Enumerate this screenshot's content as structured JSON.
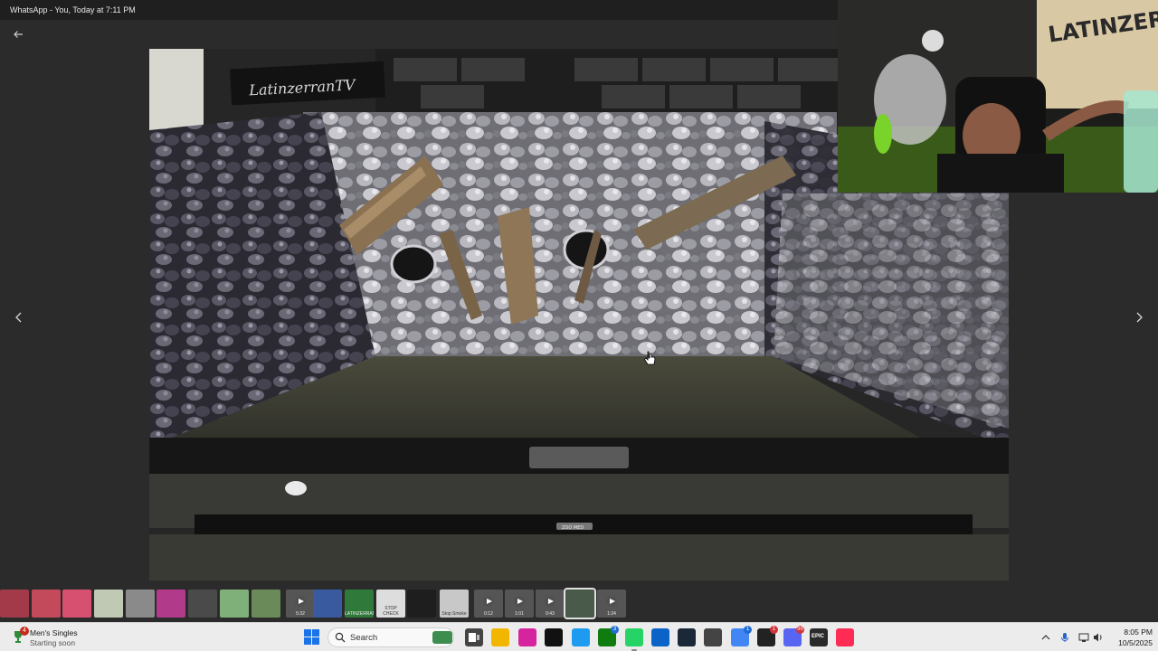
{
  "window": {
    "title": "WhatsApp - You, Today at 7:11 PM"
  },
  "viewer": {
    "back_icon": "arrow-left-icon",
    "prev_icon": "chevron-left-icon",
    "next_icon": "chevron-right-icon",
    "photo_sign_text": "LatinzerranTV",
    "photo_brand_text": "ZOO MED"
  },
  "webcam": {
    "wall_text": "LATINZER"
  },
  "thumbnails": [
    {
      "kind": "image",
      "color": "#a23a4a",
      "label": ""
    },
    {
      "kind": "image",
      "color": "#c24a5a",
      "label": ""
    },
    {
      "kind": "image",
      "color": "#d85070",
      "label": ""
    },
    {
      "kind": "image",
      "color": "#bfc9b4",
      "label": ""
    },
    {
      "kind": "image",
      "color": "#8a8a8a",
      "label": ""
    },
    {
      "kind": "image",
      "color": "#b23a8a",
      "label": ""
    },
    {
      "kind": "image",
      "color": "#4a4a4a",
      "label": ""
    },
    {
      "kind": "image",
      "color": "#7fb07a",
      "label": ""
    },
    {
      "kind": "image",
      "color": "#6a8a5a",
      "label": ""
    },
    {
      "kind": "video",
      "color": "#555555",
      "label": "5:32"
    },
    {
      "kind": "image",
      "color": "#3a5aa0",
      "label": ""
    },
    {
      "kind": "image",
      "color": "#2f7a3a",
      "label": "LATINZERRAN"
    },
    {
      "kind": "image",
      "color": "#dddddd",
      "label": "STOP CHECK"
    },
    {
      "kind": "image",
      "color": "#1e1e1e",
      "label": ""
    },
    {
      "kind": "image",
      "color": "#c8c8c8",
      "label": "Stop Smoke"
    },
    {
      "kind": "video",
      "color": "#555555",
      "label": "0:12"
    },
    {
      "kind": "video",
      "color": "#555555",
      "label": "1:01"
    },
    {
      "kind": "video",
      "color": "#555555",
      "label": "0:43"
    },
    {
      "kind": "image",
      "color": "#4a5a4a",
      "label": ""
    },
    {
      "kind": "video",
      "color": "#555555",
      "label": "1:24"
    }
  ],
  "taskbar": {
    "notification": {
      "title": "Men's Singles",
      "subtitle": "Starting soon",
      "badge": "4",
      "icon": "trophy-icon"
    },
    "search_label": "Search",
    "apps": [
      {
        "name": "file-explorer-icon",
        "color": "#f2b600",
        "badge": ""
      },
      {
        "name": "instagram-icon",
        "color": "#d6249f",
        "badge": ""
      },
      {
        "name": "tiktok-icon",
        "color": "#111111",
        "badge": ""
      },
      {
        "name": "twitter-icon",
        "color": "#1d9bf0",
        "badge": ""
      },
      {
        "name": "xbox-icon",
        "color": "#107c10",
        "badge": "3"
      },
      {
        "name": "whatsapp-icon",
        "color": "#25d366",
        "badge": ""
      },
      {
        "name": "store-icon",
        "color": "#0a64c8",
        "badge": ""
      },
      {
        "name": "steam-icon",
        "color": "#1b2838",
        "badge": ""
      },
      {
        "name": "game-icon",
        "color": "#444444",
        "badge": ""
      },
      {
        "name": "chrome-icon",
        "color": "#4285f4",
        "badge": "1"
      },
      {
        "name": "app-icon",
        "color": "#222222",
        "badge": "1"
      },
      {
        "name": "discord-icon",
        "color": "#5865f2",
        "badge": "99"
      },
      {
        "name": "epic-games-icon",
        "color": "#2a2a2a",
        "badge": ""
      },
      {
        "name": "tiktok-live-icon",
        "color": "#fe2c55",
        "badge": ""
      }
    ],
    "epic_label": "EPIC",
    "clock_time": "8:05 PM",
    "clock_date": "10/5/2025"
  }
}
